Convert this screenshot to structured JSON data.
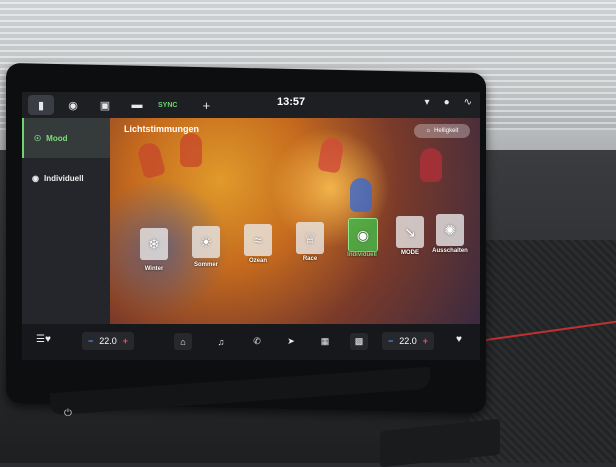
{
  "topbar": {
    "icons": [
      "car-icon",
      "assist-icon",
      "car-front-icon",
      "car-side-icon"
    ],
    "sync_label": "SYNC",
    "add_label": "+",
    "time": "13:57",
    "volume_icon": "speaker-icon",
    "user_icon": "user-icon",
    "wifi_icon": "connectivity-icon"
  },
  "sidebar": {
    "items": [
      {
        "label": "Mood",
        "icon": "mood-icon",
        "active": true
      },
      {
        "label": "Individuell",
        "icon": "individual-icon",
        "active": false
      }
    ]
  },
  "main": {
    "title": "Lichtstimmungen",
    "brightness_label": "Helligkeit",
    "tiles": [
      {
        "label": "Winter",
        "icon": "snow-icon",
        "active": false
      },
      {
        "label": "Sommer",
        "icon": "sun-icon",
        "active": false
      },
      {
        "label": "Ozean",
        "icon": "wave-icon",
        "active": false
      },
      {
        "label": "Race",
        "icon": "trophy-icon",
        "active": false
      },
      {
        "label": "Individuell",
        "icon": "individual-tile-icon",
        "active": true
      },
      {
        "label": "MODE",
        "icon": "mode-icon",
        "active": false
      },
      {
        "label": "Ausschalten",
        "icon": "off-icon",
        "active": false
      }
    ]
  },
  "bottombar": {
    "left_temp": "22.0",
    "right_temp": "22.0",
    "minus": "−",
    "plus": "+",
    "nav_icons": [
      "home-icon",
      "music-icon",
      "phone-icon",
      "navigation-icon",
      "apps-icon",
      "menu-icon"
    ]
  },
  "colors": {
    "accent": "#6fd46f",
    "plus": "#ff4a4a",
    "minus": "#5aa0ff"
  }
}
